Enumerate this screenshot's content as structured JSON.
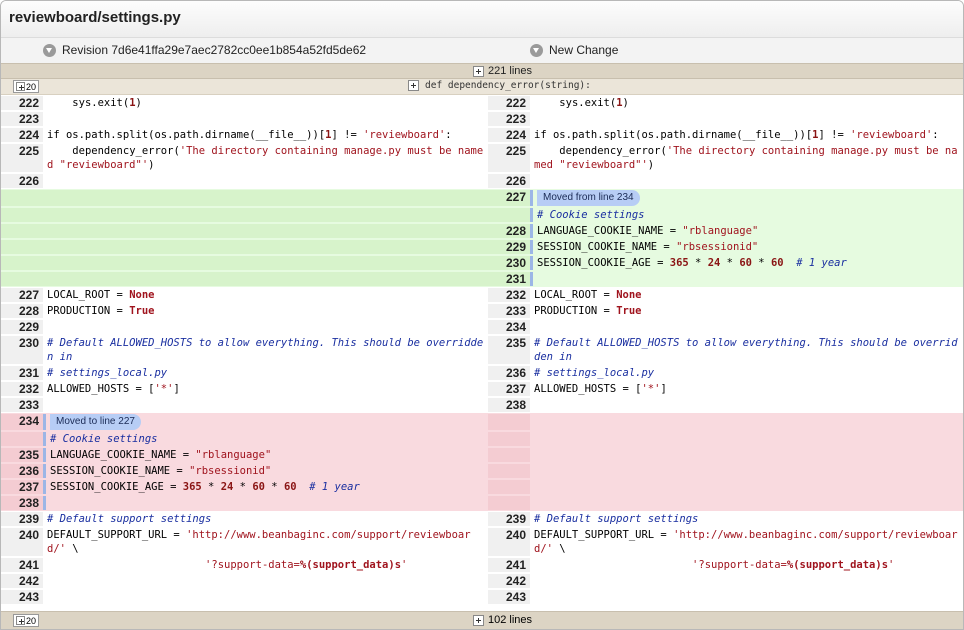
{
  "file": {
    "title": "reviewboard/settings.py"
  },
  "revisions": {
    "left": "Revision 7d6e41ffa29e7aec2782cc0ee1b854a52fd5de62",
    "right": "New Change"
  },
  "top_collapsed": {
    "label": "221 lines"
  },
  "header": {
    "expand_label": "20",
    "function": "def dependency_error(string):"
  },
  "bottom_collapsed": {
    "label": "102 lines",
    "expand_label": "20"
  },
  "badges": {
    "moved_from": "Moved from line 234",
    "moved_to": "Moved to line 227"
  },
  "lines": {
    "l222": "222",
    "l223": "223",
    "l224": "224",
    "l225": "225",
    "l226": "226",
    "r227": "227",
    "r228": "228",
    "r229": "229",
    "r230": "230",
    "r231": "231",
    "l227": "227",
    "l228": "228",
    "l229": "229",
    "l230": "230",
    "l231": "231",
    "l232": "232",
    "l233": "233",
    "r232": "232",
    "r233": "233",
    "r234": "234",
    "r235": "235",
    "r236": "236",
    "r237": "237",
    "r238": "238",
    "l234": "234",
    "l235": "235",
    "l236": "236",
    "l237": "237",
    "l238": "238",
    "l239": "239",
    "l240": "240",
    "l241": "241",
    "l242": "242",
    "l243": "243"
  },
  "code": {
    "sys_exit_pre": "    sys.exit(",
    "sys_exit_num": "1",
    "sys_exit_post": ")",
    "if_pre": "if os.path.split(os.path.dirname(__file__))[",
    "if_num": "1",
    "if_post": "] != ",
    "if_str": "'reviewboard'",
    "if_end": ":",
    "dep_pre": "    dependency_error(",
    "dep_str": "'The directory containing manage.py must be named \"reviewboard\"'",
    "dep_post": ")",
    "cookie_cmt": "# Cookie settings",
    "lang_pre": "LANGUAGE_COOKIE_NAME = ",
    "lang_str": "\"rblanguage\"",
    "sess_pre": "SESSION_COOKIE_NAME = ",
    "sess_str": "\"rbsessionid\"",
    "age_pre": "SESSION_COOKIE_AGE = ",
    "age_365": "365",
    "times": " * ",
    "age_24": "24",
    "age_60a": "60",
    "age_60b": "60",
    "age_cmt": "  # 1 year",
    "local_pre": "LOCAL_ROOT = ",
    "local_kw": "None",
    "prod_pre": "PRODUCTION = ",
    "prod_kw": "True",
    "allowed_cmt": "# Default ALLOWED_HOSTS to allow everything. This should be overridden in",
    "settings_cmt": "# settings_local.py",
    "hosts_pre": "ALLOWED_HOSTS = [",
    "hosts_str": "'*'",
    "hosts_post": "]",
    "support_cmt": "# Default support settings",
    "url_pre": "DEFAULT_SUPPORT_URL = ",
    "url_str": "'http://www.beanbaginc.com/support/reviewboard/'",
    "url_post": " \\",
    "sd_indent": "                         ",
    "sd_str1": "'?support-data=",
    "sd_fmt": "%(support_data)s",
    "sd_str2": "'"
  }
}
